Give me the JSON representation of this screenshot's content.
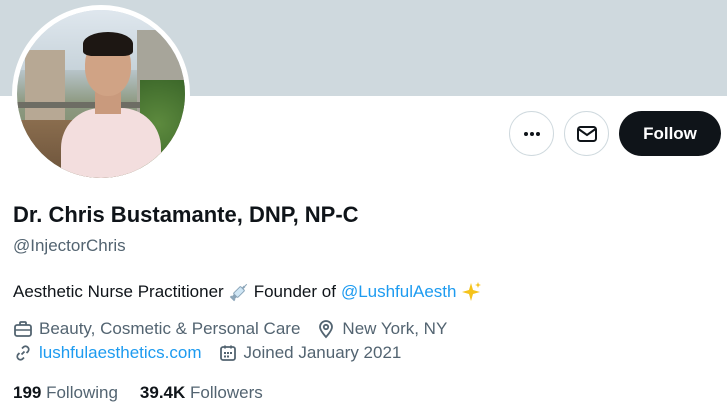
{
  "profile": {
    "name": "Dr. Chris Bustamante, DNP, NP-C",
    "handle": "@InjectorChris",
    "bio_prefix": "Aesthetic Nurse Practitioner",
    "bio_middle": "Founder of",
    "bio_mention": "@LushfulAesth"
  },
  "actions": {
    "more_icon": "more-icon",
    "message_icon": "mail-icon",
    "follow_label": "Follow"
  },
  "meta": {
    "category": "Beauty, Cosmetic & Personal Care",
    "location": "New York, NY",
    "website": "lushfulaesthetics.com",
    "joined": "Joined January 2021"
  },
  "stats": {
    "following_count": "199",
    "following_label": "Following",
    "followers_count": "39.4K",
    "followers_label": "Followers"
  },
  "colors": {
    "banner": "#cfd9de",
    "link": "#1d9bf0",
    "secondary_text": "#536471",
    "primary_text": "#0f1419",
    "follow_button": "#0f1419"
  }
}
